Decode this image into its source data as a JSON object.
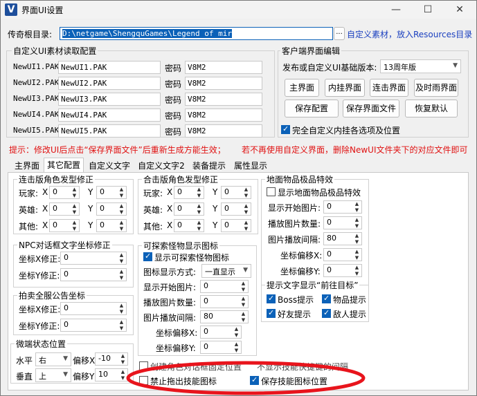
{
  "window": {
    "title": "界面UI设置",
    "minimize": "—",
    "maximize": "☐",
    "close": "✕"
  },
  "path": {
    "label": "传奇根目录:",
    "value": "D:\\netgame\\ShengquGames\\Legend of mir",
    "browse": "...",
    "resource_hint": "自定义素材，放入Resources目录"
  },
  "custom_ui": {
    "title": "自定义UI素材读取配置",
    "rows": [
      {
        "name": "NewUI1.PAK",
        "file": "NewUI1.PAK",
        "pwd_label": "密码",
        "pwd": "V8M2"
      },
      {
        "name": "NewUI2.PAK",
        "file": "NewUI2.PAK",
        "pwd_label": "密码",
        "pwd": "V8M2"
      },
      {
        "name": "NewUI3.PAK",
        "file": "NewUI3.PAK",
        "pwd_label": "密码",
        "pwd": "V8M2"
      },
      {
        "name": "NewUI4.PAK",
        "file": "NewUI4.PAK",
        "pwd_label": "密码",
        "pwd": "V8M2"
      },
      {
        "name": "NewUI5.PAK",
        "file": "NewUI5.PAK",
        "pwd_label": "密码",
        "pwd": "V8M2"
      }
    ]
  },
  "client": {
    "title": "客户端界面编辑",
    "version_label": "发布或自定义UI基础版本:",
    "version": "13周年版",
    "buttons": [
      "主界面",
      "内挂界面",
      "连击界面",
      "及时雨界面",
      "保存配置",
      "保存界面文件",
      "恢复默认"
    ],
    "full_custom": "完全自定义内挂各选项及位置"
  },
  "hint": {
    "left": "提示：修改UI后点击“保存界面文件”后重新生成方能生效；",
    "right": "若不再使用自定义界面，删除NewUI文件夹下的对应文件即可"
  },
  "tabs": [
    "主界面",
    "其它配置",
    "自定义文字",
    "自定义文字2",
    "装备提示",
    "属性显示"
  ],
  "hair1": {
    "title": "连击版角色发型修正",
    "rows": [
      {
        "label": "玩家:",
        "x": "0",
        "y": "0"
      },
      {
        "label": "英雄:",
        "x": "0",
        "y": "0"
      },
      {
        "label": "其他:",
        "x": "0",
        "y": "0"
      }
    ],
    "xl": "X",
    "yl": "Y"
  },
  "hair2": {
    "title": "合击版角色发型修正",
    "rows": [
      {
        "label": "玩家:",
        "x": "0",
        "y": "0"
      },
      {
        "label": "英雄:",
        "x": "0",
        "y": "0"
      },
      {
        "label": "其他:",
        "x": "0",
        "y": "0"
      }
    ],
    "xl": "X",
    "yl": "Y"
  },
  "ground": {
    "title": "地面物品极品特效",
    "show": "显示地面物品极品特效",
    "rows": [
      {
        "label": "显示开始图片:",
        "value": "0"
      },
      {
        "label": "播放图片数量:",
        "value": "0"
      },
      {
        "label": "图片播放间隔:",
        "value": "80"
      },
      {
        "label": "坐标偏移X:",
        "value": "0"
      },
      {
        "label": "坐标偏移Y:",
        "value": "0"
      }
    ]
  },
  "npc": {
    "title": "NPC对话框文字坐标修正",
    "rows": [
      {
        "label": "坐标X修正:",
        "value": "0"
      },
      {
        "label": "坐标Y修正:",
        "value": "0"
      }
    ]
  },
  "monster": {
    "title": "可探索怪物显示图标",
    "show": "显示可探索怪物图标",
    "mode_label": "图标显示方式:",
    "mode": "一直显示",
    "rows": [
      {
        "label": "显示开始图片:",
        "value": "0"
      },
      {
        "label": "播放图片数量:",
        "value": "0"
      },
      {
        "label": "图片播放间隔:",
        "value": "80"
      },
      {
        "label": "坐标偏移X:",
        "value": "0"
      },
      {
        "label": "坐标偏移Y:",
        "value": "0"
      }
    ]
  },
  "auction": {
    "title": "拍卖全服公告坐标",
    "rows": [
      {
        "label": "坐标X修正:",
        "value": "0"
      },
      {
        "label": "坐标Y修正:",
        "value": "0"
      }
    ]
  },
  "target": {
    "title": "提示文字显示“前往目标”",
    "items": [
      "Boss提示",
      "物品提示",
      "好友提示",
      "敌人提示"
    ]
  },
  "micro": {
    "title": "微端状态位置",
    "h_label": "水平",
    "h": "右",
    "hx_label": "偏移X",
    "hx": "-10",
    "v_label": "垂直",
    "v": "上",
    "vy_label": "偏移Y",
    "vy": "10"
  },
  "bottom": {
    "partial1": "创建角色对话框固定位置",
    "partial2": "不显示技能快捷键的间隔",
    "no_drag": "禁止拖出技能图标",
    "save_pos": "保存技能图标位置"
  },
  "accent": "#0b61b8",
  "hint_color": "#e01010",
  "annotation_color": "#e8141c"
}
